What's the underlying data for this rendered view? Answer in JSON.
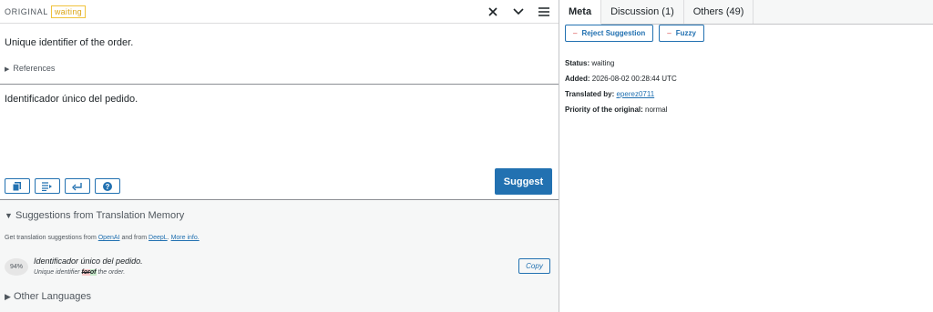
{
  "original": {
    "label": "ORIGINAL",
    "status_badge": "waiting",
    "text": "Unique identifier of the order.",
    "references_label": "References"
  },
  "top_icons": [
    "close-icon",
    "chevron-down-icon",
    "menu-icon"
  ],
  "translation": {
    "text": "Identificador único del pedido."
  },
  "toolbar": {
    "buttons": [
      "copy-original-icon",
      "insert-tab-icon",
      "insert-newline-icon",
      "help-icon"
    ],
    "suggest_label": "Suggest"
  },
  "tm": {
    "heading": "Suggestions from Translation Memory",
    "get_prefix": "Get translation suggestions from",
    "openai": "OpenAI",
    "and_from": "and from",
    "deepl": "DeepL",
    "more_info": "More info.",
    "suggestion": {
      "percent": "94%",
      "text": "Identificador único del pedido.",
      "diff_before": "Unique identifier",
      "diff_del": "for",
      "diff_ins": "of",
      "diff_after": "the order.",
      "copy_label": "Copy"
    },
    "other_languages": "Other Languages"
  },
  "sidebar": {
    "tabs": [
      "Meta",
      "Discussion (1)",
      "Others (49)"
    ],
    "reject_label": "Reject Suggestion",
    "fuzzy_label": "Fuzzy",
    "minus": "–",
    "meta": {
      "status_key": "Status:",
      "status_val": "waiting",
      "added_key": "Added:",
      "added_val": "2026-08-02 00:28:44 UTC",
      "translated_key": "Translated by:",
      "translated_val": "eperez0711",
      "priority_key": "Priority of the original:",
      "priority_val": "normal"
    }
  },
  "colors": {
    "accent": "#2271b1",
    "waiting": "#dba617",
    "danger": "#d63638"
  }
}
